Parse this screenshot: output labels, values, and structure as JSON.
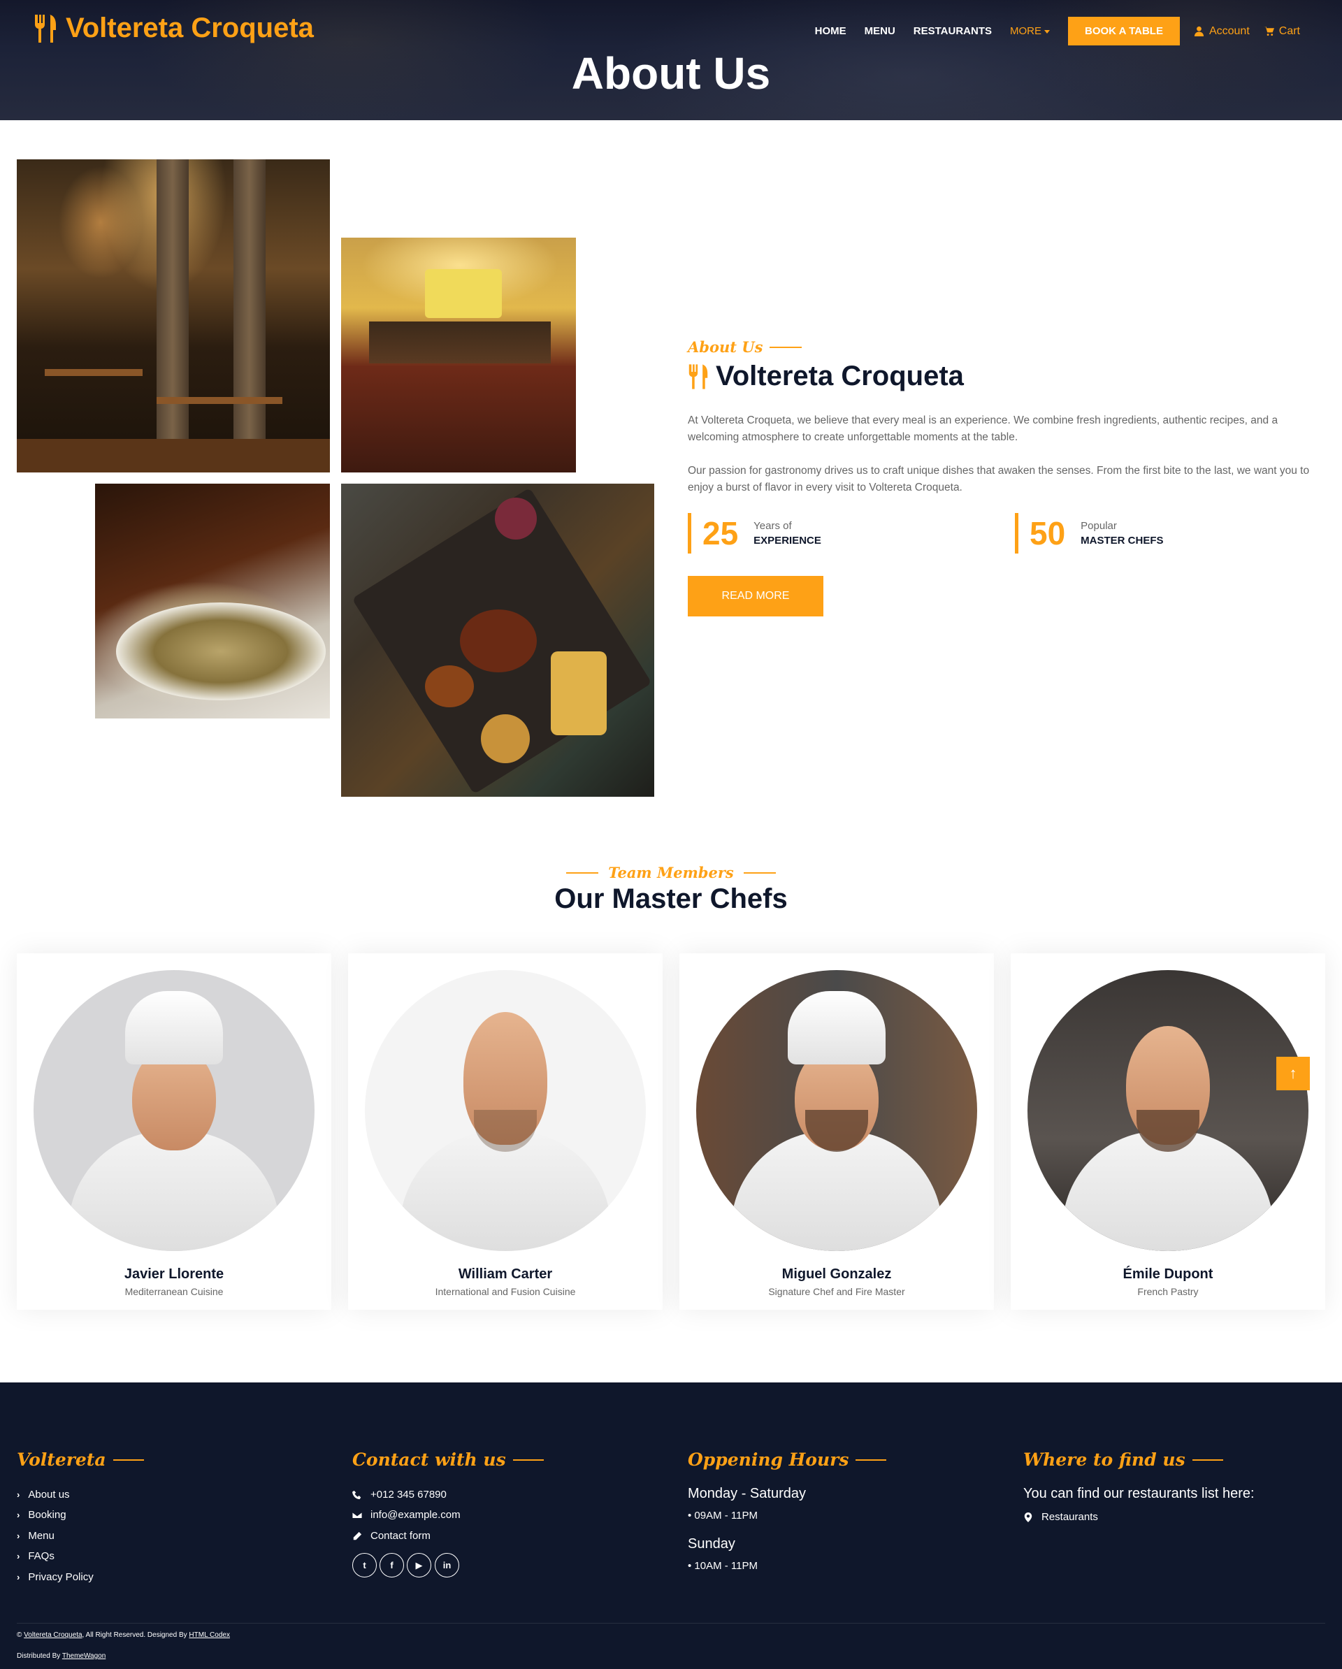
{
  "brand": {
    "name": "Voltereta Croqueta",
    "icon": "utensils-icon",
    "accent": "#fea116",
    "dark": "#0f172b"
  },
  "nav": {
    "items": [
      "HOME",
      "MENU",
      "RESTAURANTS"
    ],
    "more": "MORE",
    "book": "BOOK A TABLE",
    "account": "Account",
    "cart": "Cart"
  },
  "hero": {
    "title": "About Us"
  },
  "about": {
    "subtitle": "About Us",
    "title": "Voltereta Croqueta",
    "p1": "At Voltereta Croqueta, we believe that every meal is an experience. We combine fresh ingredients, authentic recipes, and a welcoming atmosphere to create unforgettable moments at the table.",
    "p2": "Our passion for gastronomy drives us to craft unique dishes that awaken the senses. From the first bite to the last, we want you to enjoy a burst of flavor in every visit to Voltereta Croqueta.",
    "stats": [
      {
        "number": "25",
        "label_top": "Years of",
        "label_bottom": "EXPERIENCE"
      },
      {
        "number": "50",
        "label_top": "Popular",
        "label_bottom": "MASTER CHEFS"
      }
    ],
    "button": "READ MORE"
  },
  "team": {
    "subtitle": "Team Members",
    "title": "Our Master Chefs",
    "chefs": [
      {
        "name": "Javier Llorente",
        "role": "Mediterranean Cuisine"
      },
      {
        "name": "William Carter",
        "role": "International and Fusion Cuisine"
      },
      {
        "name": "Miguel Gonzalez",
        "role": "Signature Chef and Fire Master"
      },
      {
        "name": "Émile Dupont",
        "role": "French Pastry"
      }
    ]
  },
  "footer": {
    "col1": {
      "title": "Voltereta",
      "links": [
        "About us",
        "Booking",
        "Menu",
        "FAQs",
        "Privacy Policy"
      ]
    },
    "col2": {
      "title": "Contact with us",
      "phone": "+012 345 67890",
      "email": "info@example.com",
      "form": "Contact form",
      "social": [
        "twitter-icon",
        "facebook-icon",
        "youtube-icon",
        "linkedin-icon"
      ]
    },
    "col3": {
      "title": "Oppening Hours",
      "day1": "Monday - Saturday",
      "hours1": "• 09AM - 11PM",
      "day2": "Sunday",
      "hours2": "• 10AM - 11PM"
    },
    "col4": {
      "title": "Where to find us",
      "text": "You can find our restaurants list here:",
      "link": "Restaurants"
    },
    "copy_prefix": "©",
    "copy_brand": "Voltereta Croqueta",
    "copy_mid": ", All Right Reserved. Designed By",
    "copy_designer": "HTML Codex",
    "dist_prefix": "Distributed By",
    "dist_name": "ThemeWagon"
  }
}
